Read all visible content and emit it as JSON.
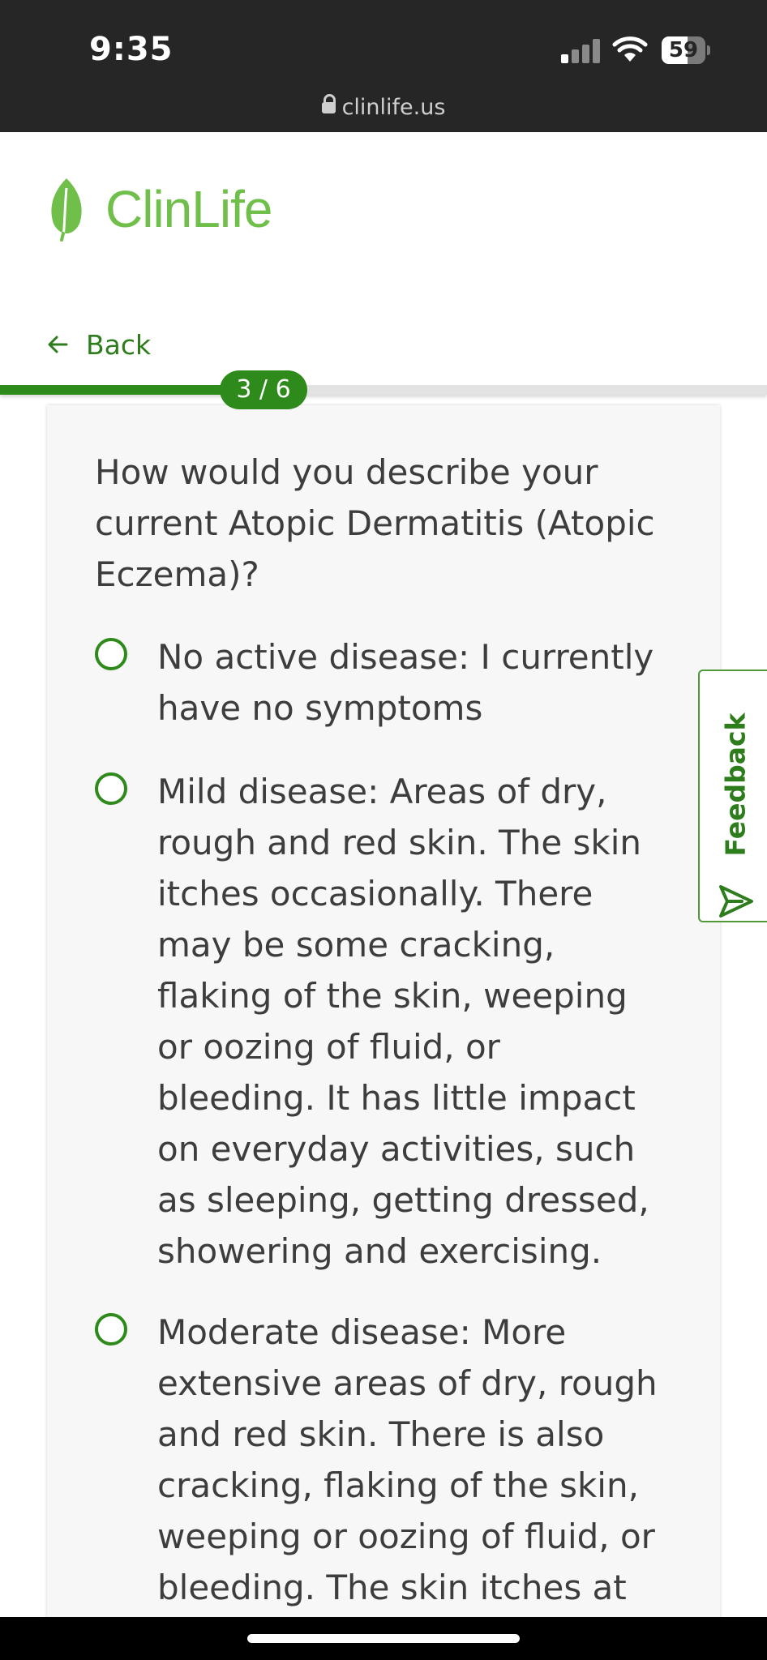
{
  "status_bar": {
    "time": "9:35",
    "battery_level": "59",
    "url": "clinlife.us"
  },
  "logo": {
    "text": "ClinLife",
    "brand_color": "#6fbf4a"
  },
  "nav": {
    "back_label": "Back",
    "back_icon": "arrow-left-icon"
  },
  "progress": {
    "label": "3 / 6",
    "current": 3,
    "total": 6,
    "accent_color": "#2e8a1b"
  },
  "question": {
    "text": "How would you describe your current Atopic Dermatitis (Atopic Eczema)?",
    "options": [
      {
        "label": "No active disease: I currently have no symptoms"
      },
      {
        "label": "Mild disease: Areas of dry, rough and red skin. The skin itches occasionally. There may be some cracking, flaking of the skin, weeping or oozing of fluid, or bleeding. It has little impact on everyday activities, such as sleeping, getting dressed, showering and exercising."
      },
      {
        "label": "Moderate disease: More extensive areas of dry, rough and red skin. There is also cracking, flaking of the skin, weeping or oozing of fluid, or bleeding. The skin itches at"
      }
    ]
  },
  "feedback": {
    "label": "Feedback",
    "icon": "send-icon"
  }
}
